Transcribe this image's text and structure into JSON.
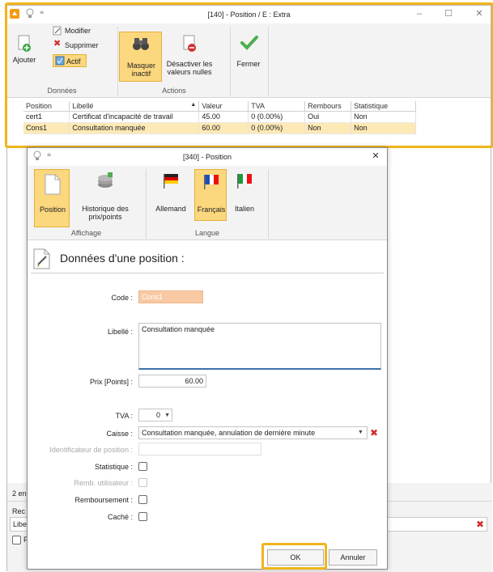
{
  "back_window": {
    "title": "[140] - Position / E : Extra",
    "ribbon": {
      "ajouter": "Ajouter",
      "modifier": "Modifier",
      "supprimer": "Supprimer",
      "actif": "Actif",
      "group_donnees": "Données",
      "masquer_line1": "Masquer",
      "masquer_line2": "inactif",
      "desactiver_line1": "Désactiver les",
      "desactiver_line2": "valeurs nulles",
      "fermer": "Fermer",
      "group_actions": "Actions"
    },
    "table": {
      "columns": [
        "Position",
        "Libellé",
        "Valeur",
        "TVA",
        "Rembours",
        "Statistique"
      ],
      "rows": [
        {
          "position": "cert1",
          "libelle": "Certificat d'incapacité de travail",
          "valeur": "45.00",
          "tva": "0 (0.00%)",
          "rembours": "Oui",
          "statistique": "Non"
        },
        {
          "position": "Cons1",
          "libelle": "Consultation manquée",
          "valeur": "60.00",
          "tva": "0 (0.00%)",
          "rembours": "Non",
          "statistique": "Non"
        }
      ]
    },
    "bottom": {
      "count_text": "2 en",
      "search_text": "Rec",
      "libe_text": "Libe",
      "check_text": "F"
    }
  },
  "dialog": {
    "title": "[340] - Position",
    "ribbon": {
      "position": "Position",
      "historique_line1": "Historique des",
      "historique_line2": "prix/points",
      "group_affichage": "Affichage",
      "allemand": "Allemand",
      "francais": "Français",
      "italien": "Italien",
      "group_langue": "Langue"
    },
    "heading": "Données d'une position :",
    "form": {
      "code_label": "Code :",
      "code_value": "Cons1",
      "libelle_label": "Libellé :",
      "libelle_value": "Consultation manquée",
      "prix_label": "Prix [Points] :",
      "prix_value": "60.00",
      "tva_label": "TVA :",
      "tva_value": "0",
      "caisse_label": "Caisse :",
      "caisse_value": "Consultation manquée, annulation de dernière minute",
      "ident_label": "Identificateur de position :",
      "statistique_label": "Statistique :",
      "remb_label": "Remb. utilisateur :",
      "remboursement_label": "Remboursement :",
      "cache_label": "Caché :"
    },
    "buttons": {
      "ok": "OK",
      "annuler": "Annuler"
    }
  },
  "colors": {
    "highlight": "#f1b51c",
    "active_button": "#fbd77e",
    "selected_row": "#fde9b5",
    "code_field": "#f8c9a3",
    "delete_red": "#d32f2f"
  }
}
